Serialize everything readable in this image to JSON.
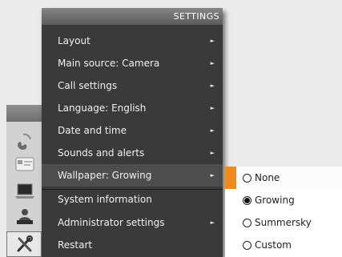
{
  "menu": {
    "title": "SETTINGS",
    "items": [
      {
        "label": "Layout",
        "has_submenu": true
      },
      {
        "label": "Main source: Camera",
        "has_submenu": true
      },
      {
        "label": "Call settings",
        "has_submenu": true
      },
      {
        "label": "Language: English",
        "has_submenu": true
      },
      {
        "label": "Date and time",
        "has_submenu": true
      },
      {
        "label": "Sounds and alerts",
        "has_submenu": true
      },
      {
        "label": "Wallpaper: Growing",
        "has_submenu": true,
        "selected": true
      },
      {
        "label": "System information",
        "has_submenu": false
      },
      {
        "label": "Administrator settings",
        "has_submenu": true
      },
      {
        "label": "Restart",
        "has_submenu": false
      }
    ],
    "arrow_glyph": "►"
  },
  "wallpaper_submenu": {
    "options": [
      {
        "label": "None",
        "checked": false,
        "focused": true
      },
      {
        "label": "Growing",
        "checked": true
      },
      {
        "label": "Summersky",
        "checked": false
      },
      {
        "label": "Custom",
        "checked": false
      }
    ]
  },
  "dock": {
    "icons": [
      "phone-handset-icon",
      "calendar-card-icon",
      "laptop-icon",
      "user-presenter-icon",
      "tools-icon"
    ],
    "selected": "tools-icon"
  },
  "colors": {
    "menu_bg": "#3a3a3a",
    "accent": "#f08a1e",
    "submenu_bg": "#ffffff"
  }
}
